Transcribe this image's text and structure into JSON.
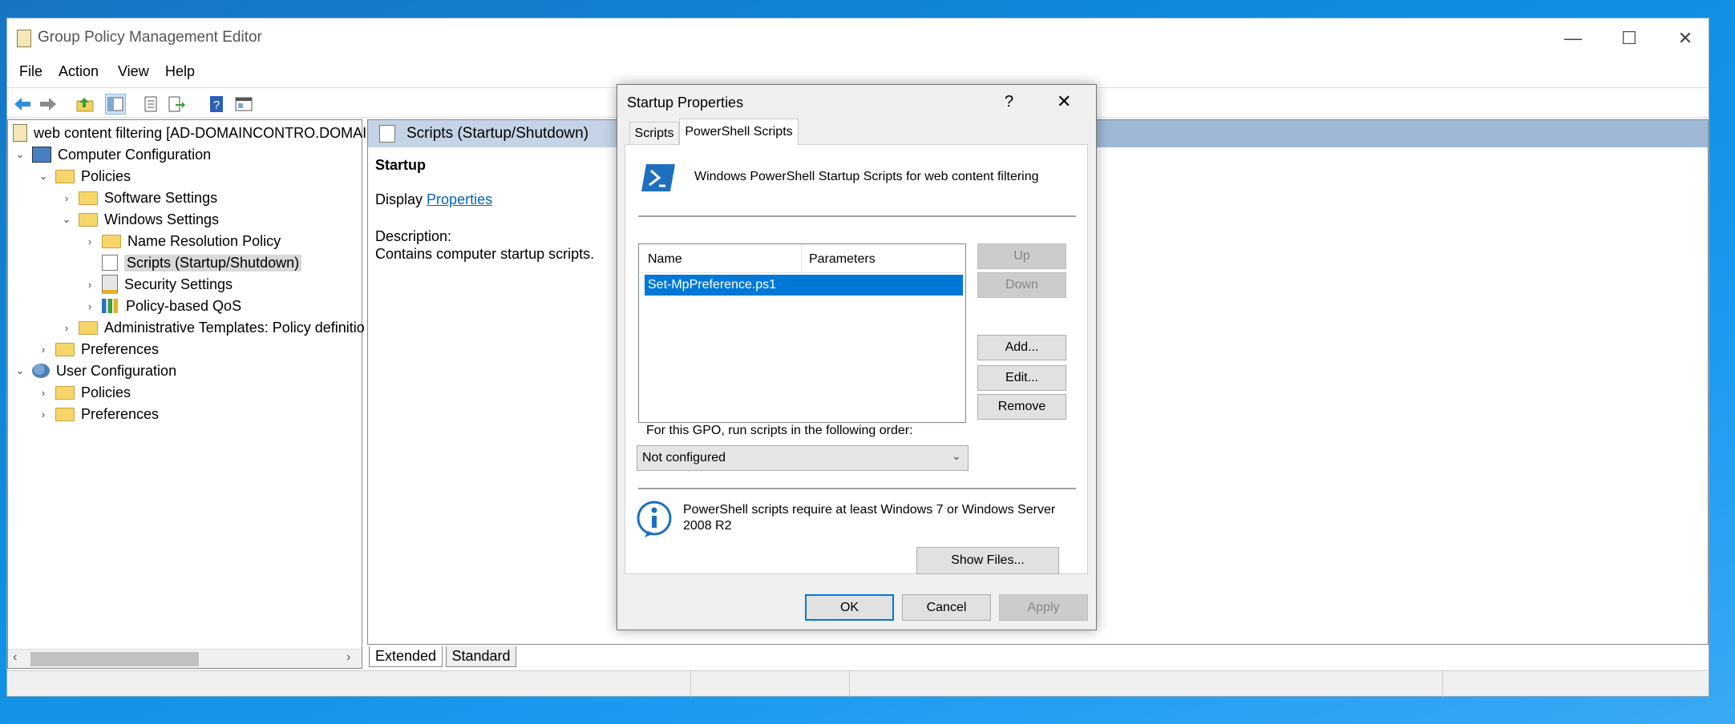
{
  "window": {
    "title": "Group Policy Management Editor",
    "minimize_glyph": "—",
    "maximize_glyph": "☐",
    "close_glyph": "✕"
  },
  "menu": [
    "File",
    "Action",
    "View",
    "Help"
  ],
  "toolbar_icons": [
    "back-arrow-icon",
    "forward-arrow-icon",
    "up-folder-icon",
    "show-hide-tree-icon",
    "properties-icon",
    "export-list-icon",
    "help-icon",
    "console-icon"
  ],
  "tree": {
    "root": "web content filtering [AD-DOMAINCONTRO.DOMAI",
    "nodes": [
      {
        "label": "Computer Configuration",
        "chevron": "⌄"
      },
      {
        "label": "Policies",
        "chevron": "⌄"
      },
      {
        "label": "Software Settings",
        "chevron": "›"
      },
      {
        "label": "Windows Settings",
        "chevron": "⌄"
      },
      {
        "label": "Name Resolution Policy",
        "chevron": "›"
      },
      {
        "label": "Scripts (Startup/Shutdown)",
        "chevron": ""
      },
      {
        "label": "Security Settings",
        "chevron": "›"
      },
      {
        "label": "Policy-based QoS",
        "chevron": "›"
      },
      {
        "label": "Administrative Templates: Policy definitio",
        "chevron": "›"
      },
      {
        "label": "Preferences",
        "chevron": "›"
      },
      {
        "label": "User Configuration",
        "chevron": "⌄"
      },
      {
        "label": "Policies",
        "chevron": "›"
      },
      {
        "label": "Preferences",
        "chevron": "›"
      }
    ]
  },
  "content": {
    "header": "Scripts (Startup/Shutdown)",
    "heading": "Startup",
    "display_label": "Display",
    "display_link": "Properties",
    "description_label": "Description:",
    "description": "Contains computer startup scripts.",
    "tabs": [
      "Extended",
      "Standard"
    ]
  },
  "dialog": {
    "title": "Startup Properties",
    "help_glyph": "?",
    "close_glyph": "✕",
    "tabs": [
      "Scripts",
      "PowerShell Scripts"
    ],
    "active_tab": "PowerShell Scripts",
    "heading": "Windows PowerShell Startup Scripts for web content filtering",
    "columns": [
      "Name",
      "Parameters"
    ],
    "rows": [
      {
        "name": "Set-MpPreference.ps1",
        "parameters": ""
      }
    ],
    "buttons": {
      "up": "Up",
      "down": "Down",
      "add": "Add...",
      "edit": "Edit...",
      "remove": "Remove",
      "show_files": "Show Files...",
      "ok": "OK",
      "cancel": "Cancel",
      "apply": "Apply"
    },
    "order_label": "For this GPO, run scripts in the following order:",
    "order_value": "Not configured",
    "info_text": "PowerShell scripts require at least Windows 7 or Windows Server 2008 R2"
  },
  "colors": {
    "selection": "#0078d7",
    "link": "#0563c1",
    "header_band": "#9fb8d6"
  }
}
